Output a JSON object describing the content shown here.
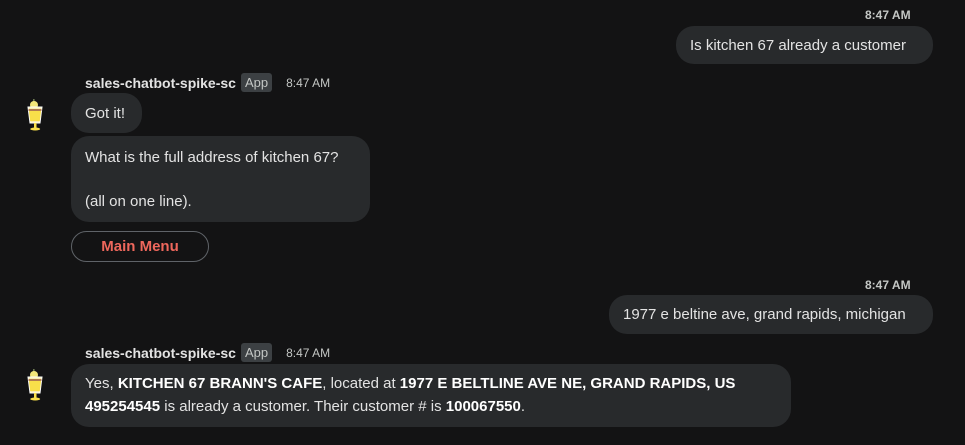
{
  "messages": {
    "m1": {
      "time": "8:47 AM",
      "text": "Is kitchen 67 already a customer"
    },
    "bot1": {
      "sender": "sales-chatbot-spike-sc",
      "badge": "App",
      "time": "8:47 AM",
      "line1": "Got it!",
      "line2": "What is the full address of kitchen 67?",
      "line3": "(all on one line).",
      "button": "Main Menu"
    },
    "m2": {
      "time": "8:47 AM",
      "text": "1977 e beltine ave, grand rapids, michigan"
    },
    "bot2": {
      "sender": "sales-chatbot-spike-sc",
      "badge": "App",
      "time": "8:47 AM",
      "t1": "Yes, ",
      "b1": "KITCHEN 67 BRANN'S CAFE",
      "t2": ", located at ",
      "b2": "1977 E BELTLINE AVE NE, GRAND RAPIDS, US",
      "b3": "495254545",
      "t3": " is already a customer. Their customer # is ",
      "b4": "100067550",
      "t4": "."
    }
  },
  "icons": {
    "avatar": "lemonade-glass-icon"
  },
  "colors": {
    "background": "#131314",
    "bubble": "#282a2c",
    "menu_button_text": "#ee675c"
  }
}
